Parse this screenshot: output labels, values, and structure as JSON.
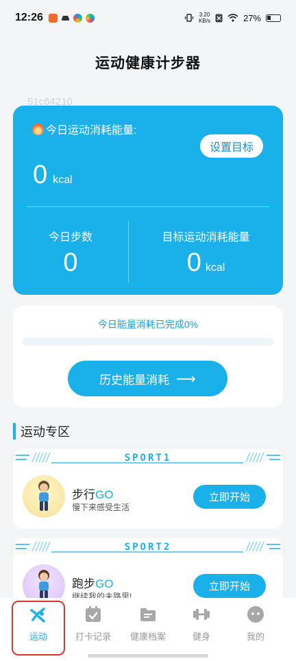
{
  "status": {
    "time": "12:26",
    "net_speed_value": "3.20",
    "net_speed_unit": "KB/s",
    "battery": "27%"
  },
  "page": {
    "title": "运动健康计步器",
    "watermark": "51c64210"
  },
  "energy_card": {
    "label": "今日运动消耗能量:",
    "set_goal_label": "设置目标",
    "value": "0",
    "unit": "kcal",
    "steps_label": "今日步数",
    "steps_value": "0",
    "goal_label": "目标运动消耗能量",
    "goal_value": "0",
    "goal_unit": "kcal"
  },
  "progress_card": {
    "status_text": "今日能量消耗已完成0%",
    "progress_percent": 0,
    "history_button_label": "历史能量消耗"
  },
  "section": {
    "title": "运动专区"
  },
  "sports": [
    {
      "banner": "SPORT1",
      "name_prefix": "步行",
      "name_suffix": "GO",
      "description": "慢下来感受生活",
      "button_label": "立即开始"
    },
    {
      "banner": "SPORT2",
      "name_prefix": "跑步",
      "name_suffix": "GO",
      "description": "继续我的未路里!",
      "button_label": "立即开始"
    }
  ],
  "tabs": [
    {
      "label": "运动",
      "icon": "run-icon",
      "active": true
    },
    {
      "label": "打卡记录",
      "icon": "calendar-check-icon",
      "active": false
    },
    {
      "label": "健康档案",
      "icon": "folder-icon",
      "active": false
    },
    {
      "label": "健身",
      "icon": "dumbbell-icon",
      "active": false
    },
    {
      "label": "我的",
      "icon": "profile-face-icon",
      "active": false
    }
  ],
  "colors": {
    "accent": "#1ab0ea",
    "highlight_box": "#d9362e"
  }
}
